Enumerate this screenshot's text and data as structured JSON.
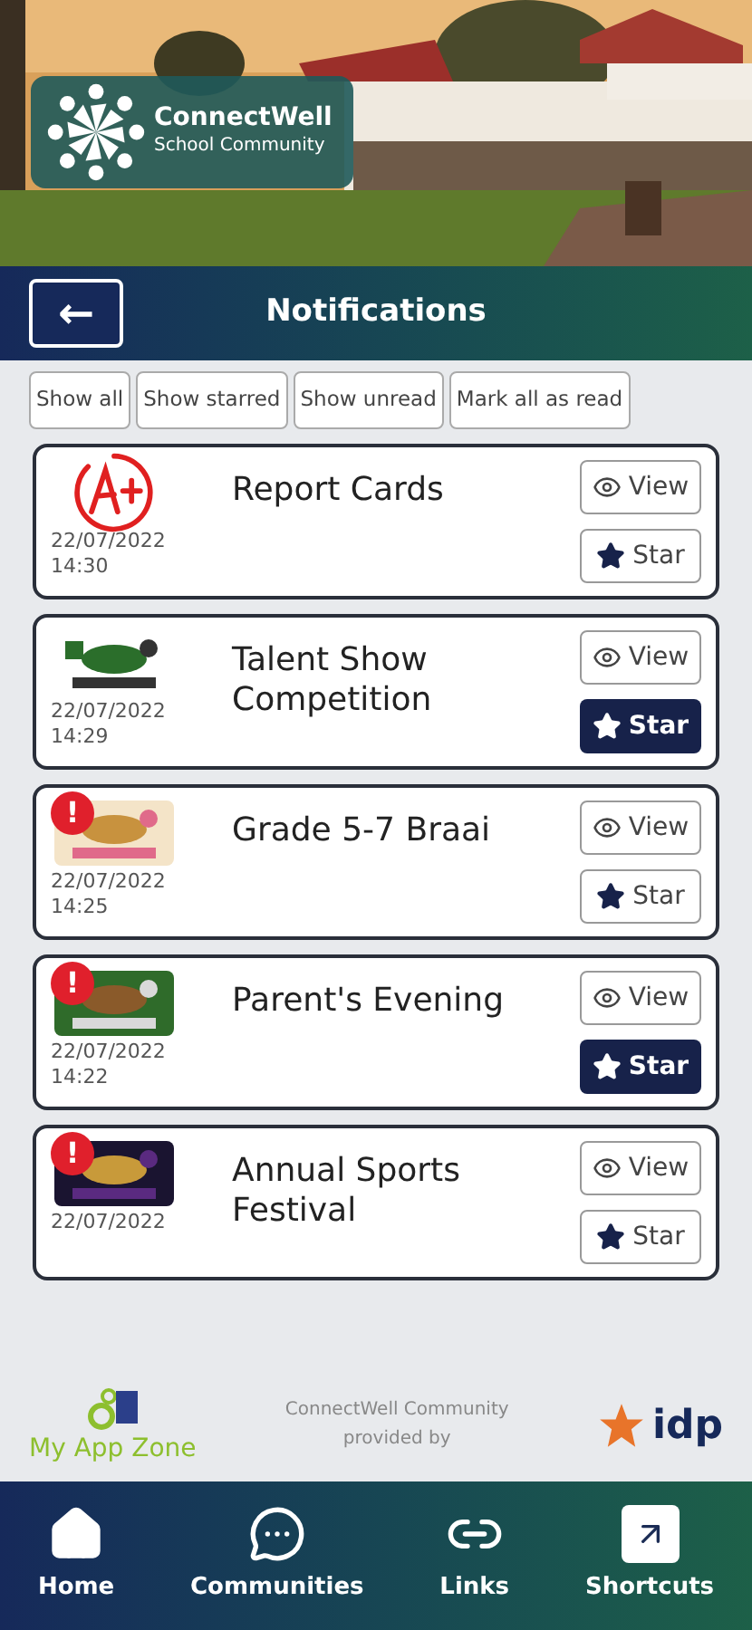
{
  "brand": {
    "name": "ConnectWell",
    "tagline": "School Community"
  },
  "header": {
    "title": "Notifications",
    "back_icon": "←"
  },
  "filters": [
    {
      "label": "Show all"
    },
    {
      "label": "Show starred"
    },
    {
      "label": "Show unread"
    },
    {
      "label": "Mark all as read"
    }
  ],
  "notifications": [
    {
      "title": "Report Cards",
      "date": "22/07/2022",
      "time": "14:30",
      "kind": "grade",
      "starred": false,
      "view": "View",
      "star": "Star"
    },
    {
      "title": "Talent Show Competition",
      "date": "22/07/2022",
      "time": "14:29",
      "kind": "picture",
      "starred": true,
      "view": "View",
      "star": "Star"
    },
    {
      "title": "Grade 5-7 Braai",
      "date": "22/07/2022",
      "time": "14:25",
      "kind": "picture",
      "badge": "!",
      "starred": false,
      "view": "View",
      "star": "Star"
    },
    {
      "title": "Parent's Evening",
      "date": "22/07/2022",
      "time": "14:22",
      "kind": "picture",
      "badge": "!",
      "starred": true,
      "view": "View",
      "star": "Star"
    },
    {
      "title": "Annual Sports Festival",
      "date": "22/07/2022",
      "kind": "picture",
      "badge": "!",
      "starred": false,
      "view": "View",
      "star": "Star"
    }
  ],
  "footer": {
    "app_zone": "My App Zone",
    "provided": "ConnectWell Community provided by",
    "partner": "idp"
  },
  "nav": [
    {
      "label": "Home",
      "kind": "home"
    },
    {
      "label": "Communities",
      "kind": "chat"
    },
    {
      "label": "Links",
      "kind": "link"
    },
    {
      "label": "Shortcuts",
      "kind": "shortcut"
    }
  ]
}
